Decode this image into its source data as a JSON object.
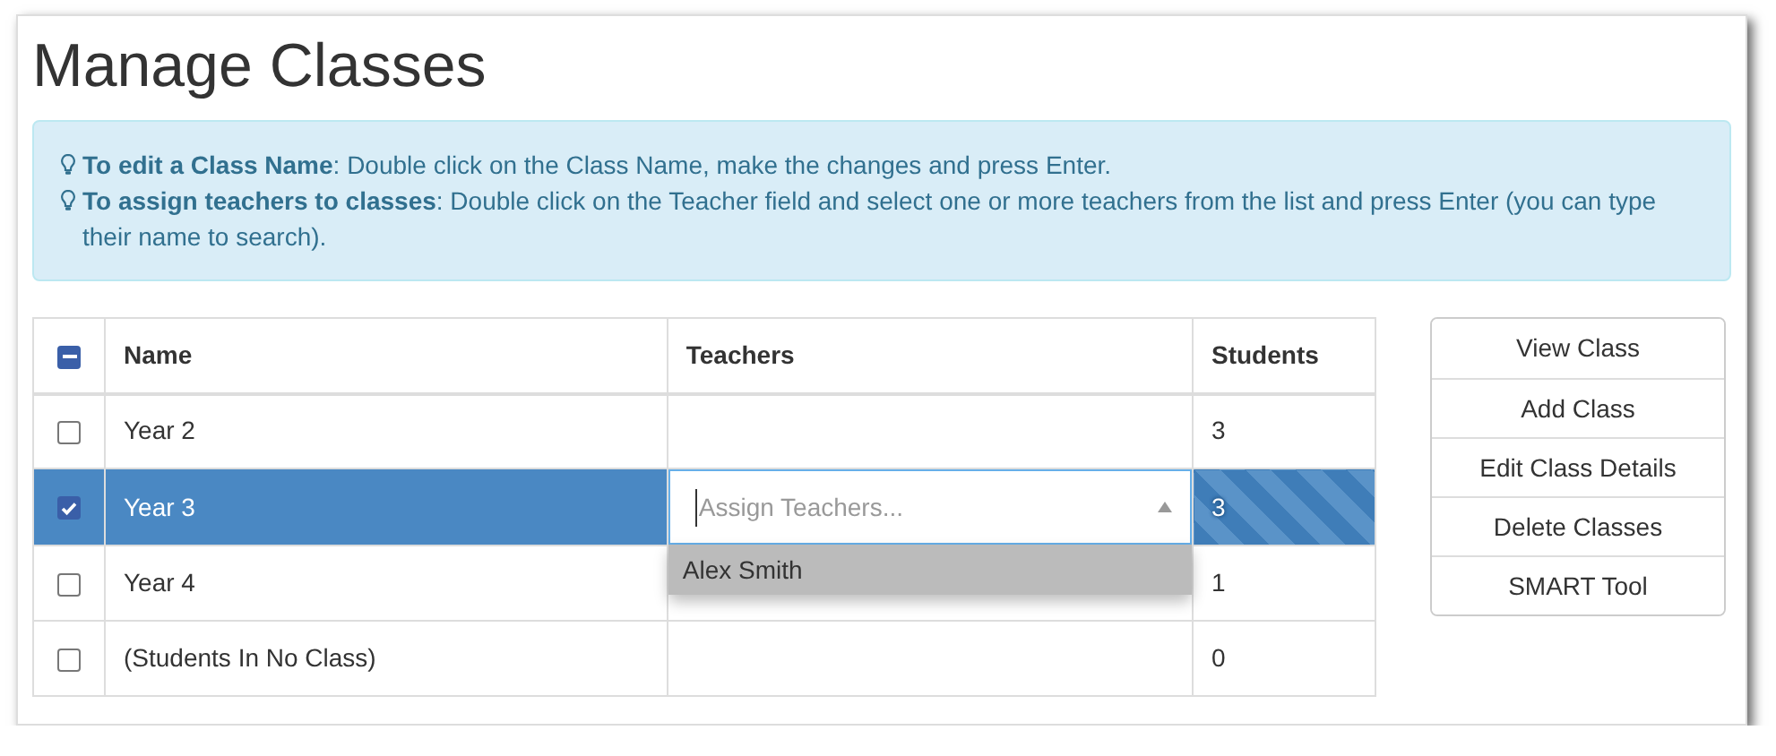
{
  "title": "Manage Classes",
  "tips": [
    "**To edit a Class Name**: Double click on the Class Name, make the changes and press Enter.",
    "**To assign teachers to classes**: Double click on the Teacher field and select one or more teachers from the list and press Enter (you can type their name to search)."
  ],
  "table": {
    "select_all": {
      "indeterminate": true
    },
    "columns": [
      "Name",
      "Teachers",
      "Students"
    ],
    "rows": [
      {
        "name": "Year 2",
        "students": "3",
        "checked": false,
        "selected": false,
        "editing": false
      },
      {
        "name": "Year 3",
        "students": "3",
        "checked": true,
        "selected": true,
        "editing": true,
        "editor": {
          "placeholder": "Assign Teachers...",
          "options": [
            {
              "label": "Alex Smith",
              "highlighted": true
            }
          ]
        }
      },
      {
        "name": "Year 4",
        "students": "1",
        "checked": false,
        "selected": false,
        "editing": false
      },
      {
        "name": "(Students In No Class)",
        "students": "0",
        "checked": false,
        "selected": false,
        "editing": false
      }
    ]
  },
  "actions": [
    "View Class",
    "Add Class",
    "Edit Class Details",
    "Delete Classes",
    "SMART Tool"
  ]
}
